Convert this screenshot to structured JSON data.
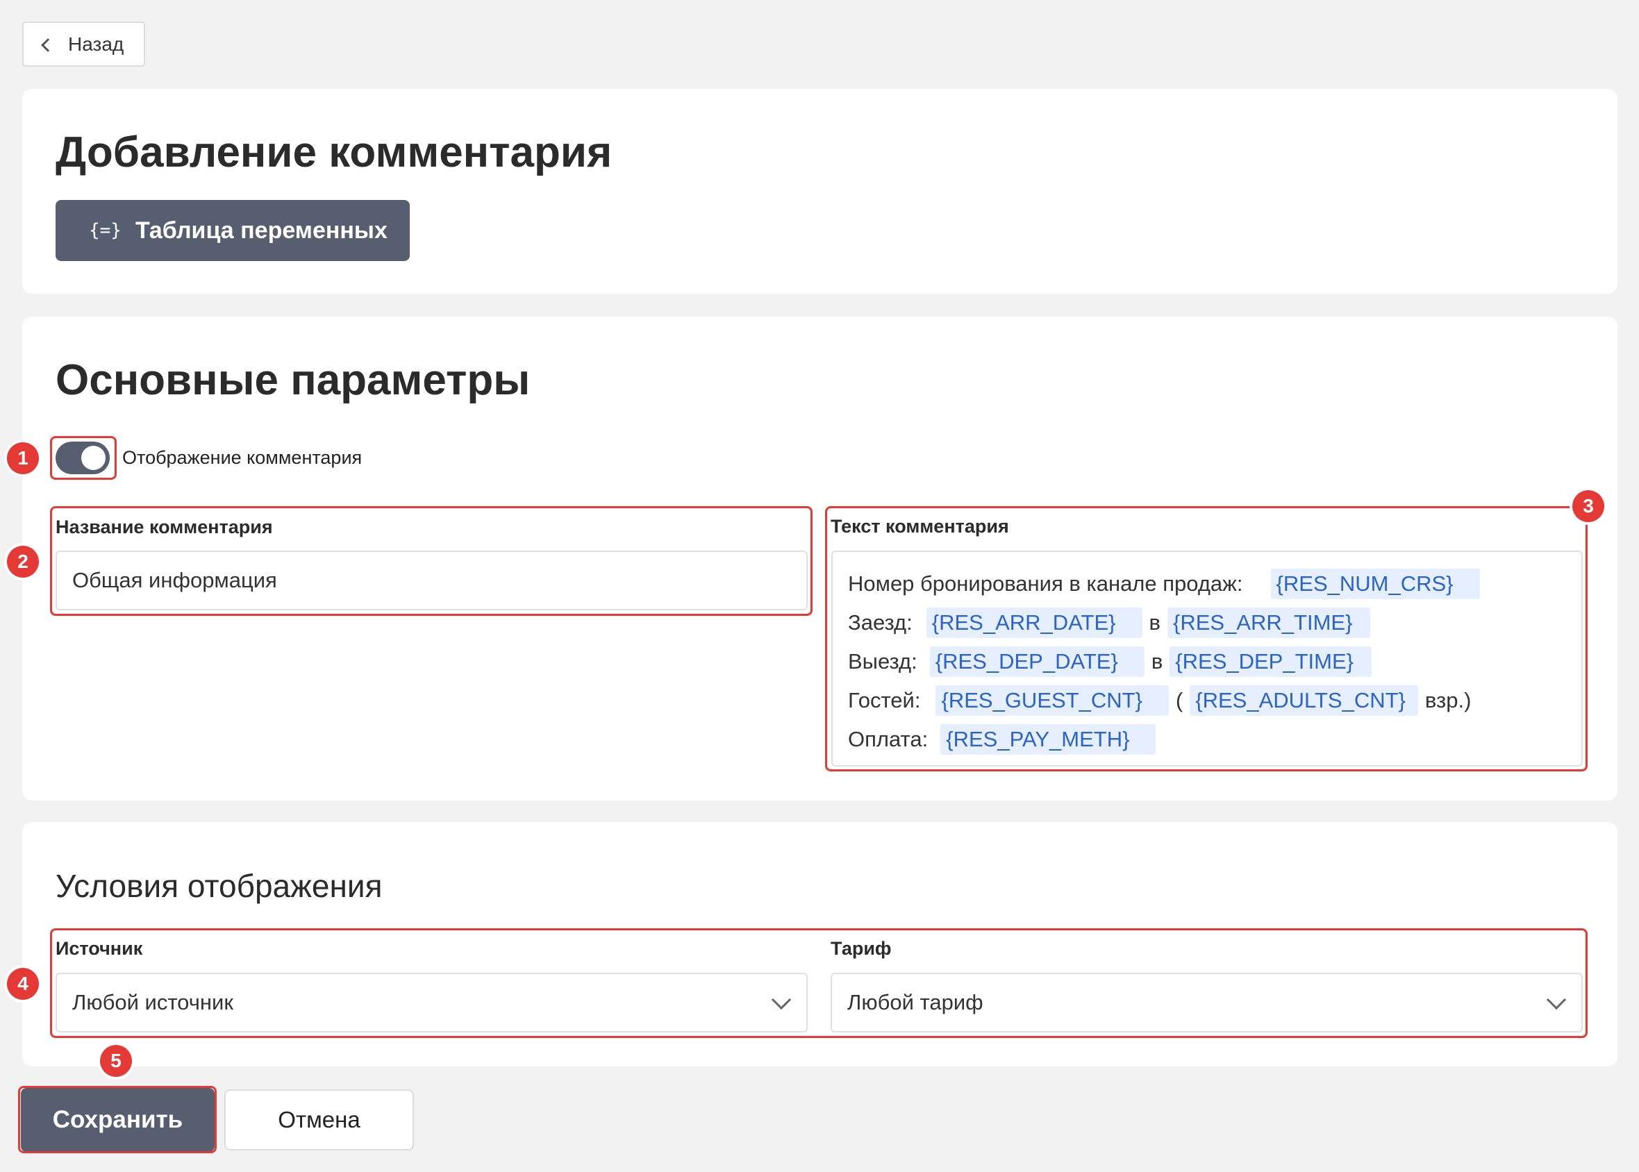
{
  "nav": {
    "back_label": "Назад"
  },
  "header": {
    "title": "Добавление комментария",
    "vars_button_icon": "{=}",
    "vars_button_label": "Таблица переменных"
  },
  "main_params": {
    "title": "Основные параметры",
    "toggle_label": "Отображение комментария",
    "toggle_on": true,
    "name_label": "Название комментария",
    "name_value": "Общая информация",
    "text_label": "Текст комментария",
    "text_lines": [
      {
        "prefix": "Номер бронирования в канале продаж:",
        "var1": "{RES_NUM_CRS}"
      },
      {
        "prefix": "Заезд:",
        "var1": "{RES_ARR_DATE}",
        "sep": "в",
        "var2": "{RES_ARR_TIME}"
      },
      {
        "prefix": "Выезд:",
        "var1": "{RES_DEP_DATE}",
        "sep": "в",
        "var2": "{RES_DEP_TIME}"
      },
      {
        "prefix": "Гостей:",
        "var1": "{RES_GUEST_CNT}",
        "sep": "(",
        "var2": "{RES_ADULTS_CNT}",
        "suffix": "взр.)"
      },
      {
        "prefix": "Оплата:",
        "var1": "{RES_PAY_METH}"
      }
    ]
  },
  "conditions": {
    "title": "Условия отображения",
    "source_label": "Источник",
    "source_value": "Любой источник",
    "tariff_label": "Тариф",
    "tariff_value": "Любой тариф"
  },
  "actions": {
    "save_label": "Сохранить",
    "cancel_label": "Отмена"
  },
  "annotations": [
    "1",
    "2",
    "3",
    "4",
    "5"
  ],
  "colors": {
    "accent": "#565e6f",
    "highlight": "#e53935",
    "variable_chip_bg": "#e6efff",
    "variable_text": "#2b63c6"
  }
}
